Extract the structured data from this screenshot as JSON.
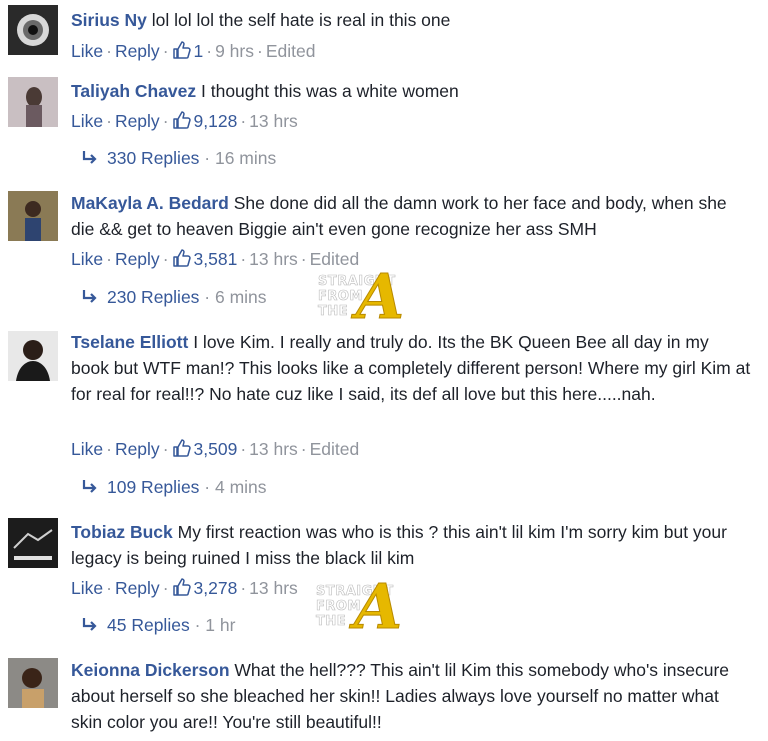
{
  "comments": [
    {
      "author": "Sirius Ny",
      "text": " lol lol lol the self hate is real in this one",
      "like": "Like",
      "reply": "Reply",
      "likes": "1",
      "time": "9 hrs",
      "edited": "Edited"
    },
    {
      "author": "Taliyah Chavez",
      "text": " I thought this was a white women",
      "like": "Like",
      "reply": "Reply",
      "likes": "9,128",
      "time": "13 hrs",
      "replies": "330 Replies",
      "replies_time": "16 mins"
    },
    {
      "author": "MaKayla A. Bedard",
      "text": " She done did all the damn work to her face and body, when she die && get to heaven Biggie ain't even gone recognize her ass SMH",
      "like": "Like",
      "reply": "Reply",
      "likes": "3,581",
      "time": "13 hrs",
      "edited": "Edited",
      "replies": "230 Replies",
      "replies_time": "6 mins"
    },
    {
      "author": "Tselane Elliott",
      "text": " I love Kim. I really and truly do. Its the BK Queen Bee all day in my book but WTF man!? This looks like a completely different person! Where my girl Kim at for real for real!!? No hate cuz like I said, its def all love but this here.....nah.",
      "like": "Like",
      "reply": "Reply",
      "likes": "3,509",
      "time": "13 hrs",
      "edited": "Edited",
      "replies": "109 Replies",
      "replies_time": "4 mins"
    },
    {
      "author": "Tobiaz Buck",
      "text": " My first reaction was who is this ? this ain't lil kim I'm sorry kim but your legacy is being ruined I miss the black lil kim",
      "like": "Like",
      "reply": "Reply",
      "likes": "3,278",
      "time": "13 hrs",
      "replies": "45 Replies",
      "replies_time": "1 hr"
    },
    {
      "author": "Keionna Dickerson",
      "text": " What the hell??? This ain't lil Kim this somebody who's insecure about herself so she bleached her skin!! Ladies always love yourself no matter what skin color you are!! You're still beautiful!!"
    }
  ],
  "watermark": {
    "line1": "STRAIGHT",
    "line2": "FROM",
    "line3": "THE",
    "letter": "A"
  },
  "colors": {
    "link": "#365899",
    "meta": "#90949c",
    "text": "#1d2129",
    "watermark": "#e6b800"
  },
  "icons": [
    "thumbs-up-icon",
    "reply-arrow-icon"
  ]
}
